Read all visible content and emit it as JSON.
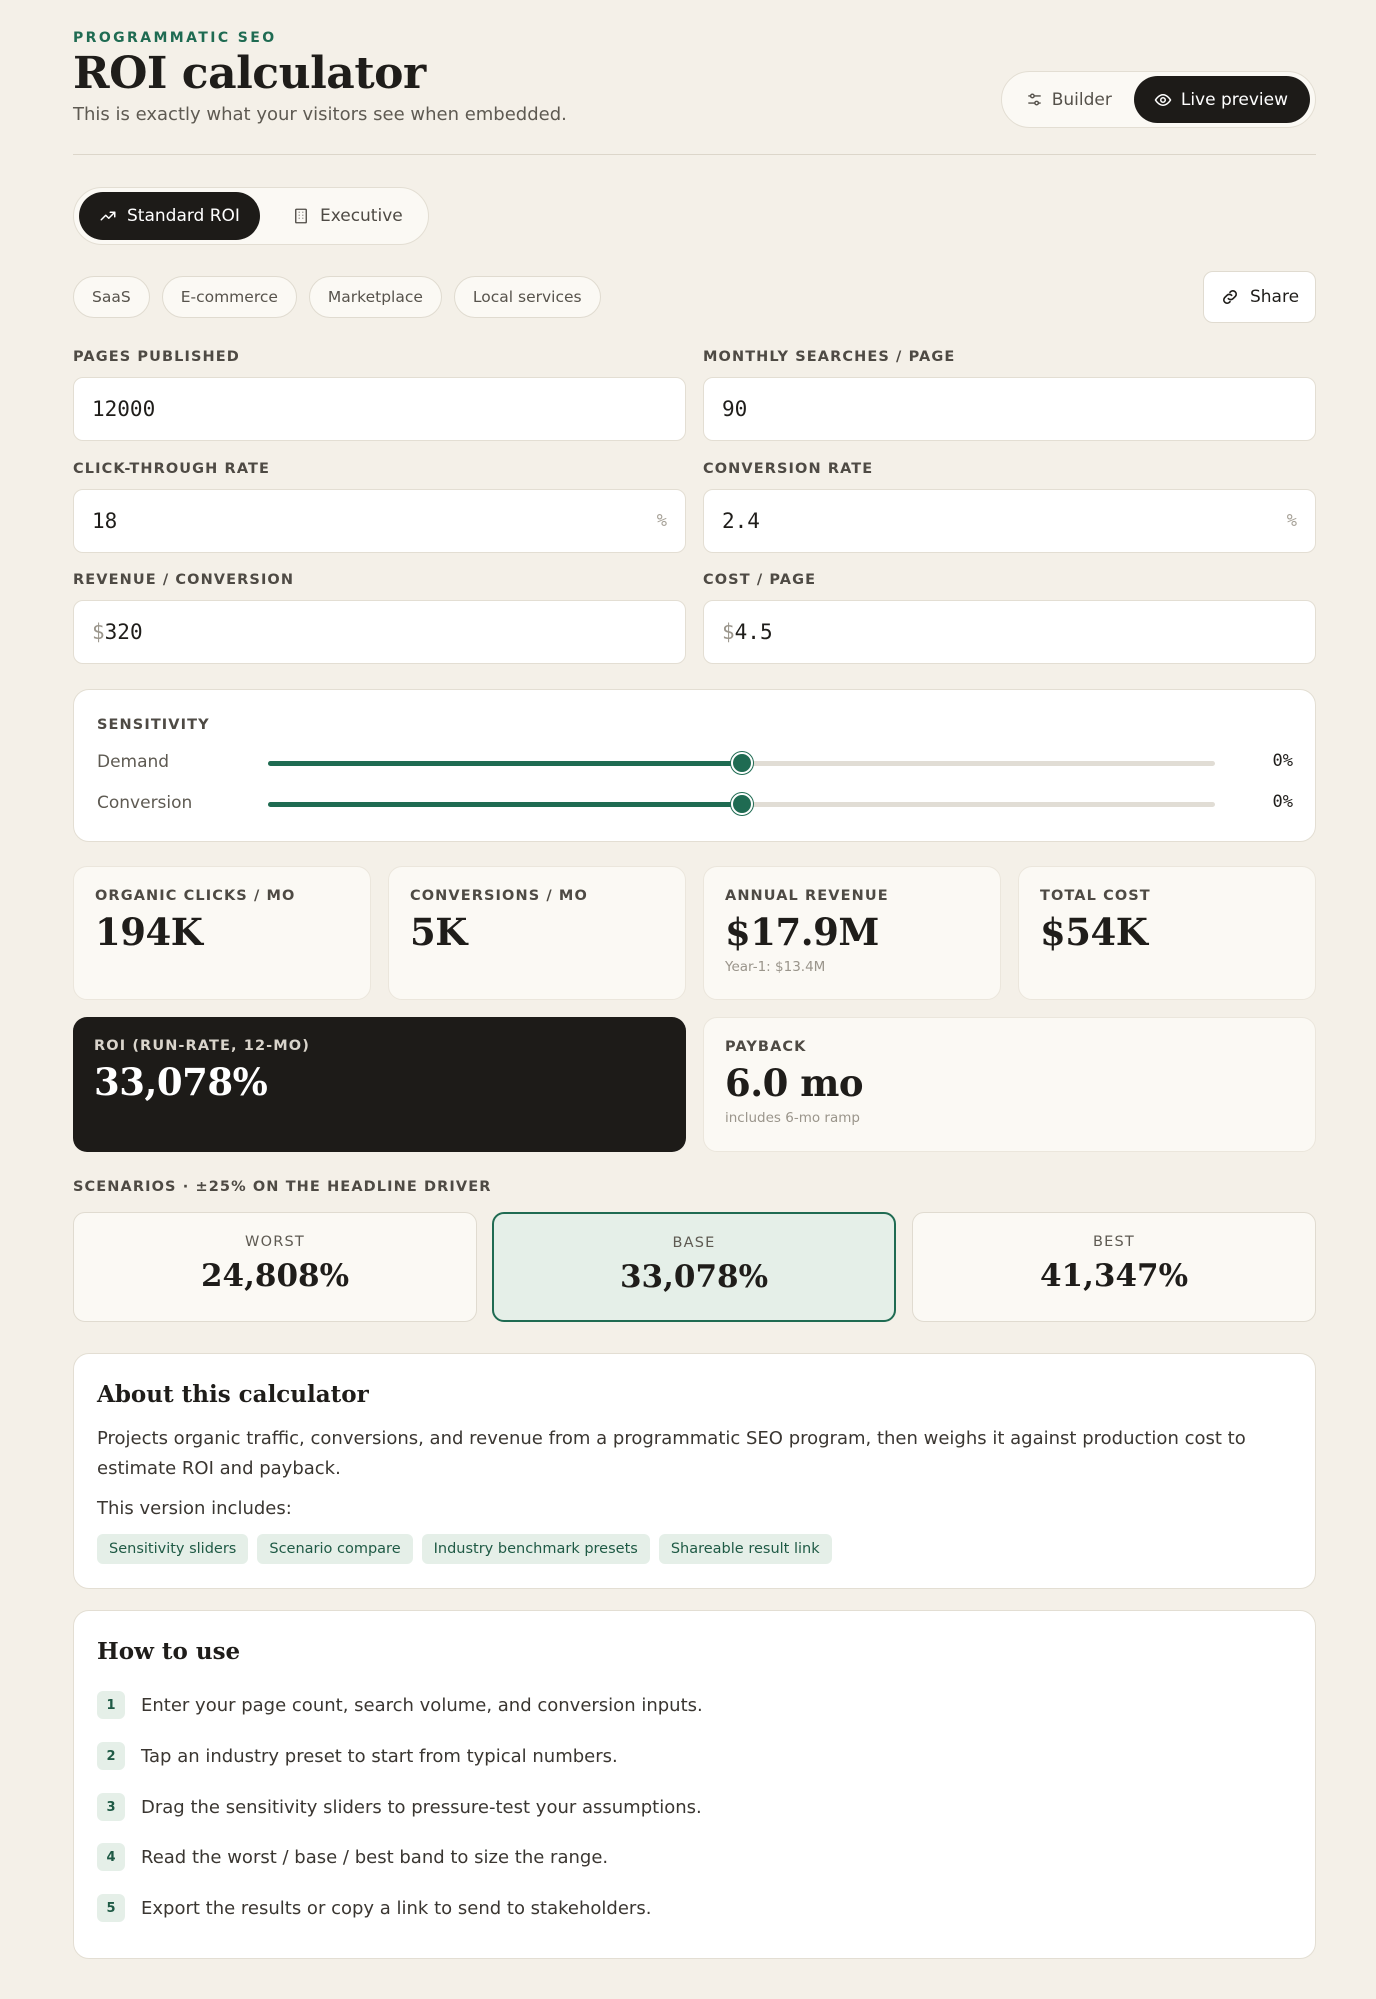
{
  "header": {
    "eyebrow": "PROGRAMMATIC SEO",
    "title": "ROI calculator",
    "subtitle": "This is exactly what your visitors see when embedded.",
    "builder_label": "Builder",
    "preview_label": "Live preview"
  },
  "tabs": [
    {
      "label": "Standard ROI",
      "icon": "trending-up-icon",
      "active": true
    },
    {
      "label": "Executive",
      "icon": "building-icon",
      "active": false
    }
  ],
  "presets": [
    "SaaS",
    "E-commerce",
    "Marketplace",
    "Local services"
  ],
  "share_label": "Share",
  "fields": {
    "pages": {
      "label": "PAGES PUBLISHED",
      "value": "12000"
    },
    "searches": {
      "label": "MONTHLY SEARCHES / PAGE",
      "value": "90"
    },
    "ctr": {
      "label": "CLICK-THROUGH RATE",
      "value": "18",
      "suffix": "%"
    },
    "conv": {
      "label": "CONVERSION RATE",
      "value": "2.4",
      "suffix": "%"
    },
    "revenue": {
      "label": "REVENUE / CONVERSION",
      "prefix": "$",
      "value": "320"
    },
    "cost": {
      "label": "COST / PAGE",
      "prefix": "$",
      "value": "4.5"
    }
  },
  "sensitivity": {
    "title": "SENSITIVITY",
    "demand": {
      "label": "Demand",
      "value": "0%",
      "position": 0.5
    },
    "conversion": {
      "label": "Conversion",
      "value": "0%",
      "position": 0.5
    }
  },
  "metrics": {
    "clicks": {
      "label": "ORGANIC CLICKS / MO",
      "value": "194K"
    },
    "conversions": {
      "label": "CONVERSIONS / MO",
      "value": "5K"
    },
    "revenue": {
      "label": "ANNUAL REVENUE",
      "value": "$17.9M",
      "note": "Year-1: $13.4M"
    },
    "cost": {
      "label": "TOTAL COST",
      "value": "$54K"
    },
    "roi": {
      "label": "ROI (RUN-RATE, 12-MO)",
      "value": "33,078%"
    },
    "payback": {
      "label": "PAYBACK",
      "value": "6.0 mo",
      "note": "includes 6-mo ramp"
    }
  },
  "scenarios": {
    "title": "SCENARIOS · ±25% ON THE HEADLINE DRIVER",
    "worst": {
      "label": "WORST",
      "value": "24,808%"
    },
    "base": {
      "label": "BASE",
      "value": "33,078%"
    },
    "best": {
      "label": "BEST",
      "value": "41,347%"
    }
  },
  "about": {
    "title": "About this calculator",
    "description": "Projects organic traffic, conversions, and revenue from a programmatic SEO program, then weighs it against production cost to estimate ROI and payback.",
    "includes_label": "This version includes:",
    "features": [
      "Sensitivity sliders",
      "Scenario compare",
      "Industry benchmark presets",
      "Shareable result link"
    ]
  },
  "howto": {
    "title": "How to use",
    "steps": [
      {
        "num": "1",
        "text": "Enter your page count, search volume, and conversion inputs."
      },
      {
        "num": "2",
        "text": "Tap an industry preset to start from typical numbers."
      },
      {
        "num": "3",
        "text": "Drag the sensitivity sliders to pressure-test your assumptions."
      },
      {
        "num": "4",
        "text": "Read the worst / base / best band to size the range."
      },
      {
        "num": "5",
        "text": "Export the results or copy a link to send to stakeholders."
      }
    ]
  },
  "colors": {
    "accent": "#1f6b52",
    "dark": "#1d1b18",
    "background": "#f4f0e8"
  }
}
